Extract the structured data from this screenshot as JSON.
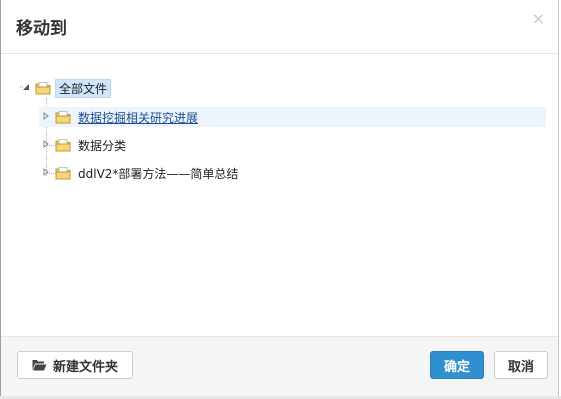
{
  "dialog": {
    "title": "移动到",
    "close_glyph": "×"
  },
  "tree": {
    "root": {
      "label": "全部文件",
      "icon": "folder-icon",
      "expanded": true
    },
    "children": [
      {
        "label": "数据挖掘相关研究进展",
        "icon": "folder-icon",
        "selected": true
      },
      {
        "label": "数据分类",
        "icon": "folder-icon"
      },
      {
        "label": "ddlV2*部署方法——简单总结",
        "icon": "folder-icon"
      }
    ]
  },
  "footer": {
    "new_folder_label": "新建文件夹",
    "new_folder_icon": "folder-open-icon",
    "confirm_label": "确定",
    "cancel_label": "取消"
  },
  "colors": {
    "primary": "#2f8fcf",
    "selection": "#cfe5fa",
    "link": "#1b4f91"
  }
}
